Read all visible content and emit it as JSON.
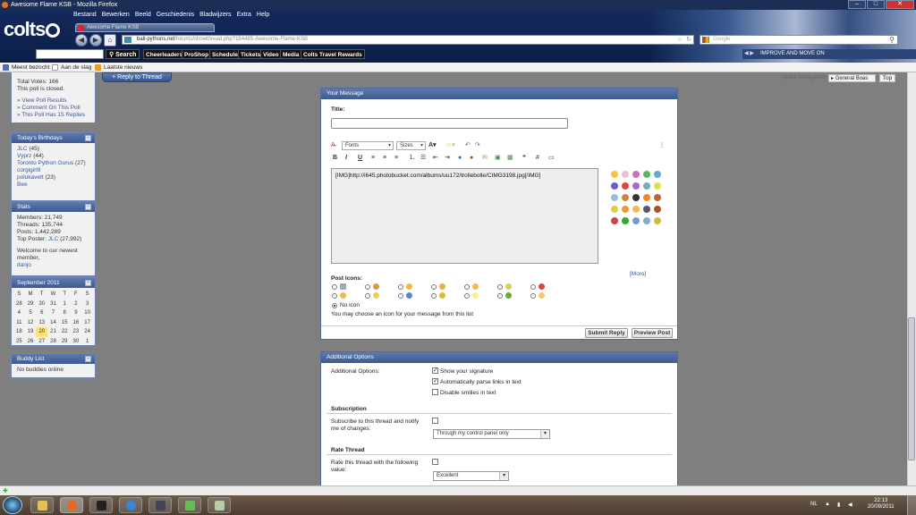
{
  "window": {
    "title": "Awesome Flame KSB - Mozilla Firefox"
  },
  "menu": [
    "Bestand",
    "Bewerken",
    "Beeld",
    "Geschiedenis",
    "Bladwijzers",
    "Extra",
    "Help"
  ],
  "tab": {
    "label": "Awesome Flame KSB"
  },
  "address": {
    "domain": "ball-pythons.net",
    "path": "/forums/showthread.php?154485-Awesome-Flame-KSB"
  },
  "google_search": {
    "placeholder": "Google"
  },
  "brand_toolbar": {
    "logo": "colts",
    "search_label": "Search",
    "links": [
      "Cheerleaders",
      "ProShop",
      "Schedule",
      "Tickets",
      "Video",
      "Media",
      "Colts Travel Rewards"
    ],
    "ticker": "IMPROVE AND MOVE ON"
  },
  "bookmarks": [
    "Meest bezocht",
    "Aan de slag",
    "Laatste nieuws"
  ],
  "poll": {
    "votes": "Total Votes: 166",
    "closed": "This poll is closed.",
    "links": [
      "» View Poll Results",
      "» Comment On This Poll",
      "» This Poll Has 15 Replies"
    ]
  },
  "birthdays": {
    "title": "Today's Birthdays",
    "entries": [
      {
        "name": "JLC",
        "age": "(45)"
      },
      {
        "name": "Vyprz",
        "age": "(44)"
      },
      {
        "name": "Toronto Python Gurus",
        "age": "(27)"
      },
      {
        "name": "corgigirl9",
        "age": ""
      },
      {
        "name": "polukavett",
        "age": "(23)"
      },
      {
        "name": "Bee",
        "age": ""
      }
    ]
  },
  "stats": {
    "title": "Stats",
    "members": "Members: 21,749",
    "threads": "Threads: 135,744",
    "posts": "Posts: 1,442,289",
    "top_poster_label": "Top Poster:",
    "top_poster": "JLC",
    "top_poster_count": "(27,992)",
    "welcome": "Welcome to our newest member,",
    "newest": "danjo"
  },
  "calendar": {
    "title": "September 2011",
    "days": [
      "S",
      "M",
      "T",
      "W",
      "T",
      "F",
      "S"
    ],
    "weeks": [
      [
        "28",
        "29",
        "30",
        "31",
        "1",
        "2",
        "3"
      ],
      [
        "4",
        "5",
        "6",
        "7",
        "8",
        "9",
        "10"
      ],
      [
        "11",
        "12",
        "13",
        "14",
        "15",
        "16",
        "17"
      ],
      [
        "18",
        "19",
        "20",
        "21",
        "22",
        "23",
        "24"
      ],
      [
        "25",
        "26",
        "27",
        "28",
        "29",
        "30",
        "1"
      ]
    ],
    "today": "20"
  },
  "buddy": {
    "title": "Buddy List",
    "text": "No buddies online"
  },
  "thread_nav": {
    "reply_button": "+ Reply to Thread",
    "quick_nav": "Quick Navigation",
    "forum_select": "General Boas",
    "top": "Top"
  },
  "message": {
    "header": "Your Message",
    "title_label": "Title:",
    "font_select": "Fonts",
    "size_select": "Sizes",
    "content": "[IMG]http://i645.photobucket.com/albums/uu172/trollebolle/CIMG3198.jpg[/IMG]",
    "more": "[More]",
    "post_icons_label": "Post Icons:",
    "no_icon": "No icon",
    "icon_hint": "You may choose an icon for your message from this list",
    "submit": "Submit Reply",
    "preview": "Preview Post"
  },
  "options": {
    "header": "Additional Options",
    "label": "Additional Options:",
    "checks": [
      "Show your signature",
      "Automatically parse links in text",
      "Disable smilies in text"
    ],
    "subscription_title": "Subscription",
    "subscription_text": "Subscribe to this thread and notify me of changes:",
    "subscription_select": "Through my control panel only",
    "rate_title": "Rate Thread",
    "rate_text": "Rate this thread with the following value:",
    "rate_select": "Excellent"
  },
  "tray": {
    "lang": "NL",
    "time": "22:13",
    "date": "20/09/2011"
  },
  "colors": {
    "accent": "#3c5a92",
    "link": "#3558a5",
    "today": "#ffe27a"
  }
}
